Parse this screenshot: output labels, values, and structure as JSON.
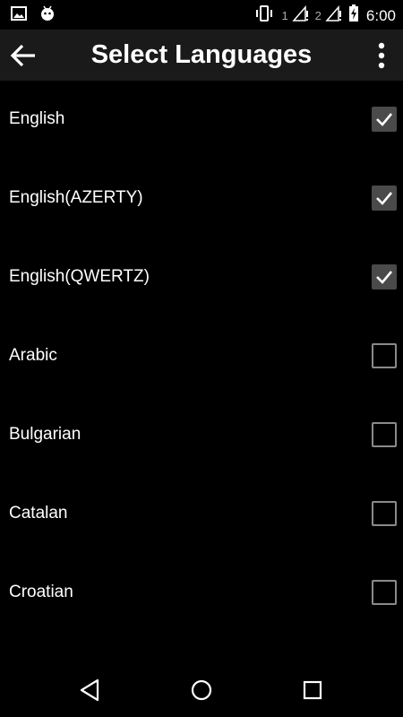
{
  "status_bar": {
    "left_icons": [
      "image-icon",
      "android-icon"
    ],
    "sim1": "1",
    "sim2": "2",
    "time": "6:00"
  },
  "app_bar": {
    "title": "Select Languages",
    "back_icon": "arrow-back-icon",
    "overflow_icon": "more-vert-icon"
  },
  "languages": [
    {
      "label": "English",
      "checked": true
    },
    {
      "label": "English(AZERTY)",
      "checked": true
    },
    {
      "label": "English(QWERTZ)",
      "checked": true
    },
    {
      "label": "Arabic",
      "checked": false
    },
    {
      "label": "Bulgarian",
      "checked": false
    },
    {
      "label": "Catalan",
      "checked": false
    },
    {
      "label": "Croatian",
      "checked": false
    }
  ],
  "nav_bar": {
    "back": "nav-back-icon",
    "home": "nav-home-icon",
    "recents": "nav-recents-icon"
  },
  "colors": {
    "background": "#000000",
    "app_bar": "#1a1a1a",
    "checkbox_checked": "#4a4a4a",
    "checkbox_border": "#8a8a8a"
  }
}
